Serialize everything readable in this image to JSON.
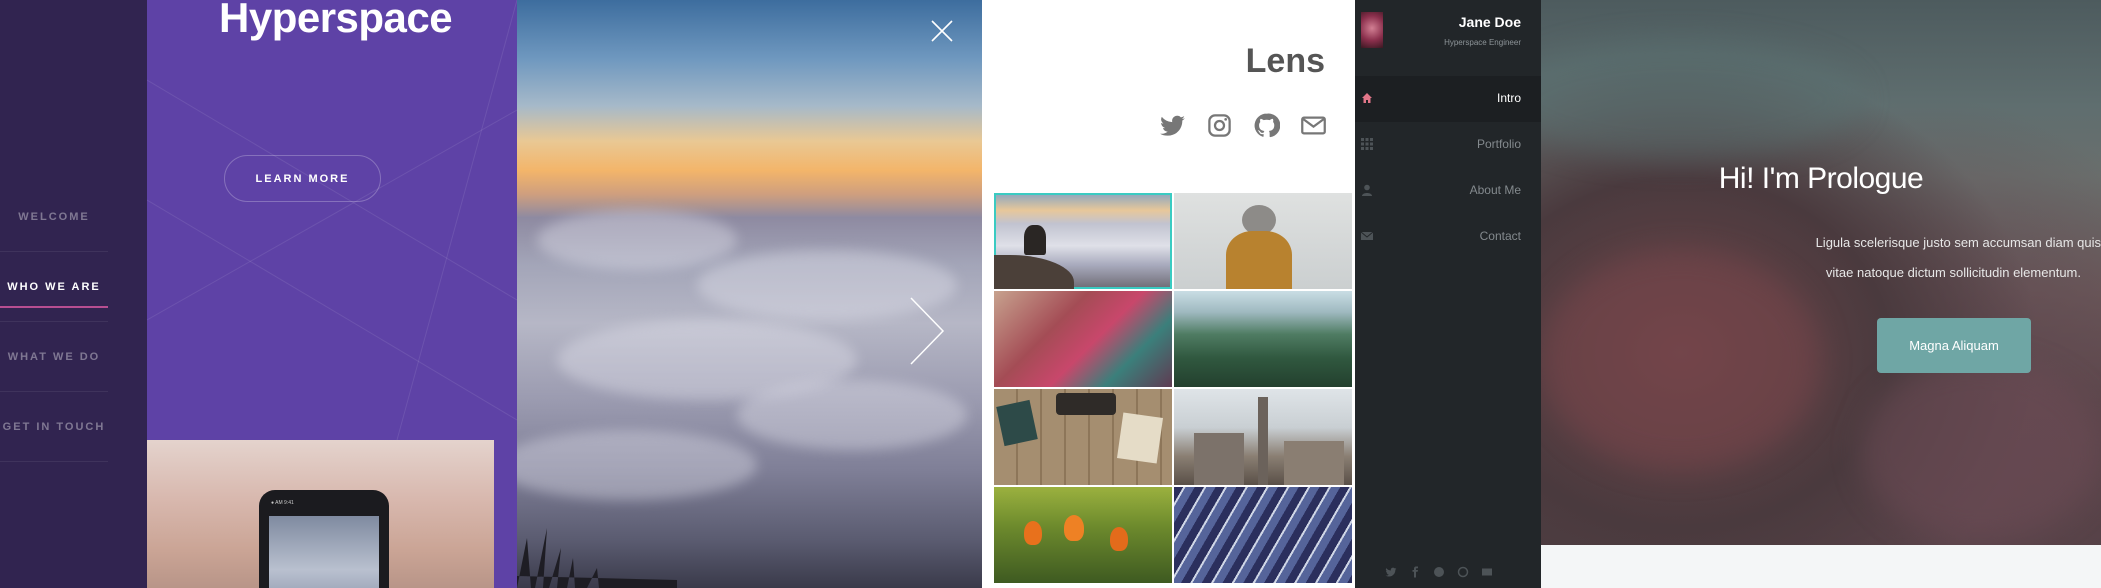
{
  "hyperspace": {
    "title": "Hyperspace",
    "button_label": "LEARN MORE",
    "nav": [
      "WELCOME",
      "WHO WE ARE",
      "WHAT WE DO",
      "GET IN TOUCH"
    ],
    "active_nav": "WHO WE ARE",
    "phone_status": "● AM   9:41"
  },
  "lightbox": {
    "close_icon": "close-icon",
    "next_icon": "chevron-right-icon"
  },
  "lens": {
    "title": "Lens",
    "social_icons": [
      "twitter-icon",
      "instagram-icon",
      "github-icon",
      "envelope-icon"
    ],
    "thumbnails": [
      "person-on-cliff-above-clouds",
      "hiker-in-yellow-jacket",
      "woman-in-colorful-scarf",
      "mountain-valley-river",
      "typewriter-on-desk",
      "city-skyline",
      "orange-tulips",
      "glass-building-ceiling"
    ],
    "selected_index": 0,
    "accent": "#3acbc2"
  },
  "prologue_sidebar": {
    "name": "Jane Doe",
    "role": "Hyperspace Engineer",
    "nav": [
      {
        "label": "Intro",
        "icon": "home-icon",
        "active": true
      },
      {
        "label": "Portfolio",
        "icon": "grid-icon",
        "active": false
      },
      {
        "label": "About Me",
        "icon": "user-icon",
        "active": false
      },
      {
        "label": "Contact",
        "icon": "envelope-icon",
        "active": false
      }
    ],
    "social_icons": [
      "twitter-icon",
      "facebook-icon",
      "github-icon",
      "dribbble-icon",
      "envelope-icon"
    ],
    "accent": "#e27689"
  },
  "prologue_hero": {
    "title": "Hi! I'm Prologue",
    "text_line1": "Ligula scelerisque justo sem accumsan diam quis",
    "text_line2": "vitae natoque dictum sollicitudin elementum.",
    "button_label": "Magna Aliquam",
    "button_color": "#6fa6a5"
  }
}
